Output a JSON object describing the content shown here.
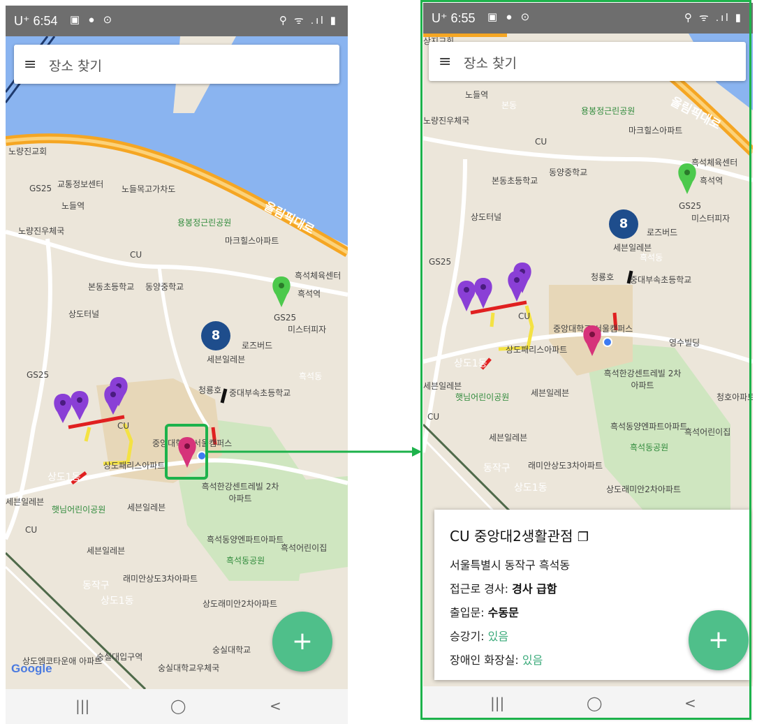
{
  "left_phone": {
    "status": {
      "time": "U⁺ 6:54",
      "left_icons": "▣ ● ⊙",
      "right_icons": "⚲ ᯤ .ıl ▮"
    },
    "search": {
      "menu_icon": "≡",
      "placeholder": "장소 찾기"
    },
    "cluster_count": "8",
    "map_labels": {
      "noryangjin_church": "노량진교회",
      "gs25_a": "GS25",
      "traffic_center": "교통정보센터",
      "noryangjin_station": "노들역",
      "overpass": "노들목고가차도",
      "olympic_road": "올림픽대로",
      "yongbong_park": "용봉정근린공원",
      "noryangjin_post": "노량진우체국",
      "markhills": "마크힐스아파트",
      "cu_a": "CU",
      "heukseok_sports": "흑석체육센터",
      "bondong_school": "본동초등학교",
      "dongyang_school": "동양중학교",
      "heukseok_station": "흑석역",
      "sangdo_tunnel": "상도터널",
      "gs25_b": "GS25",
      "mister_pizza": "미스터피자",
      "rosebud": "로즈버드",
      "seven_apt": "세븐일레븐",
      "gs25_c": "GS25",
      "cheongryongho": "청룡호",
      "cau_elem": "중대부속초등학교",
      "cu_b": "CU",
      "cau_campus": "중앙대학교 서울캠퍼스",
      "sangdo_paris": "상도패리스아파트",
      "sangdo1": "상도1동",
      "hangang_centre": "흑석한강센트레빌 2차아파트",
      "seven_a": "세븐일레븐",
      "haennim_park": "햇님어린이공원",
      "seven_b": "세븐일레븐",
      "cu_c": "CU",
      "seven_c": "세븐일레븐",
      "heukseok_dongyang": "흑석동양엔파트아파트",
      "heukseok_kinder": "흑석어린이집",
      "heukseok_park": "흑석동공원",
      "raemian3": "래미안상도3차아파트",
      "dongjak": "동작구",
      "sangdo1b": "상도1동",
      "raemian2": "상도래미안2차아파트",
      "soongsil_univ": "숭실대학교",
      "soongsil_station": "숭실대입구역",
      "soongsil_post": "숭실대학교우체국",
      "sangdo_entel": "상도엠코타운애 아파트",
      "heukseokdong": "흑석동"
    },
    "fab_icon": "+",
    "google_logo": "Google",
    "nav": {
      "recent_icon": "|||",
      "home_icon": "◯",
      "back_icon": "<"
    }
  },
  "right_phone": {
    "status": {
      "time": "U⁺ 6:55",
      "left_icons": "▣ ● ⊙",
      "right_icons": "⚲ ᯤ .ıl ▮"
    },
    "search": {
      "menu_icon": "≡",
      "placeholder": "장소 찾기"
    },
    "cluster_count": "8",
    "map_labels": {
      "top_clip": "상지교회",
      "noryangjin_station": "노들역",
      "bondong": "본동",
      "yongbong_park": "용봉정근린공원",
      "olympic_road": "올림픽대로",
      "noryangjin_post": "노량진우체국",
      "markhills": "마크힐스아파트",
      "cu_a": "CU",
      "heukseok_sports": "흑석체육센터",
      "bondong_school": "본동초등학교",
      "dongyang_school": "동양중학교",
      "heukseok_station": "흑석역",
      "sangdo_tunnel": "상도터널",
      "gs25_a": "GS25",
      "mister_pizza": "미스터피자",
      "rosebud": "로즈버드",
      "seven_apt": "세븐일레븐",
      "gs25_b": "GS25",
      "cheongryongho": "청룡호",
      "cau_elem": "중대부속초등학교",
      "cu_b": "CU",
      "cau_campus": "중앙대학교 서울캠퍼스",
      "youngsu": "영수빌딩",
      "sangdo_paris": "상도패리스아파트",
      "sangdo1": "상도1동",
      "hangang_centre": "흑석한강센트레빌 2차아파트",
      "seven_a": "세븐일레븐",
      "haennim_park": "햇님어린이공원",
      "seven_b": "세븐일레븐",
      "cheongho": "청호아파트",
      "cu_c": "CU",
      "seven_c": "세븐일레븐",
      "heukseok_dongyang": "흑석동양엔파트아파트",
      "heukseok_kinder": "흑석어린이집",
      "heukseok_park": "흑석동공원",
      "dongjak": "동작구",
      "raemian3": "래미안상도3차아파트",
      "sangdo1b": "상도1동",
      "raemian2": "상도래미안2차아파트",
      "heukseokdong": "흑석동"
    },
    "info_card": {
      "title": "CU 중앙대2생활관점",
      "copy_icon": "❐",
      "address": "서울특별시 동작구 흑석동",
      "slope_label": "접근로 경사:",
      "slope_value": "경사 급함",
      "door_label": "출입문:",
      "door_value": "수동문",
      "elevator_label": "승강기:",
      "elevator_value": "있음",
      "toilet_label": "장애인 화장실:",
      "toilet_value": "있음"
    },
    "fab_icon": "+",
    "nav": {
      "recent_icon": "|||",
      "home_icon": "◯",
      "back_icon": "<"
    }
  },
  "colors": {
    "accent_green": "#1db24b",
    "fab": "#4fbf8a",
    "cluster": "#1e4d8c",
    "pin_purple": "#8a3fd6",
    "pin_pink": "#d6337a",
    "pin_green": "#4cc94c",
    "path_red": "#e02020",
    "path_yellow": "#f4e243"
  }
}
